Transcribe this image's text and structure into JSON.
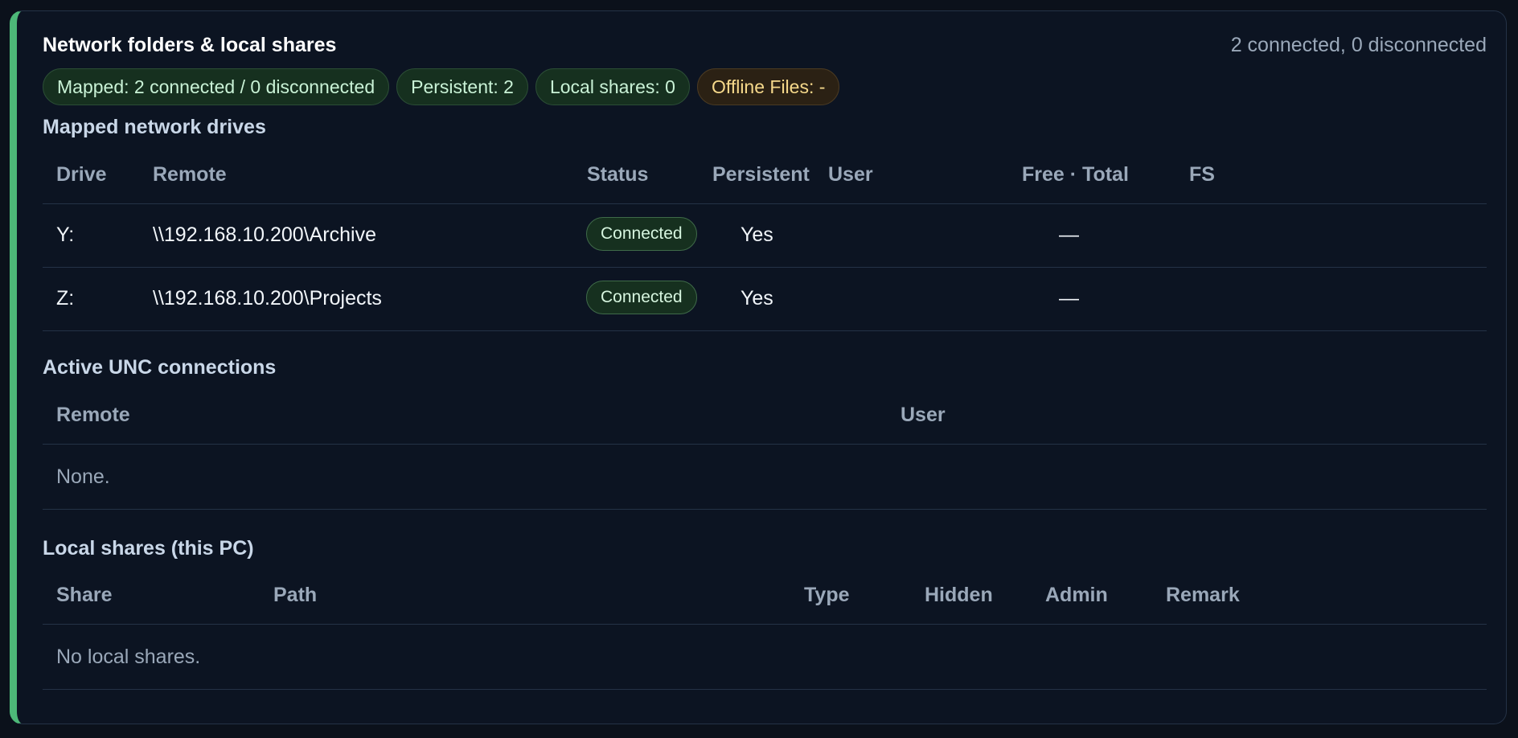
{
  "header": {
    "title": "Network folders & local shares",
    "summary": "2 connected, 0 disconnected"
  },
  "chips": [
    {
      "label": "Mapped: 2 connected / 0 disconnected",
      "tone": "green"
    },
    {
      "label": "Persistent: 2",
      "tone": "green"
    },
    {
      "label": "Local shares: 0",
      "tone": "green"
    },
    {
      "label": "Offline Files: -",
      "tone": "warn"
    }
  ],
  "mapped": {
    "title": "Mapped network drives",
    "columns": [
      "Drive",
      "Remote",
      "Status",
      "Persistent",
      "User",
      "Free · Total",
      "FS"
    ],
    "rows": [
      {
        "drive": "Y:",
        "remote": "\\\\192.168.10.200\\Archive",
        "status": "Connected",
        "persistent": "Yes",
        "user": "",
        "free_total": "—",
        "fs": ""
      },
      {
        "drive": "Z:",
        "remote": "\\\\192.168.10.200\\Projects",
        "status": "Connected",
        "persistent": "Yes",
        "user": "",
        "free_total": "—",
        "fs": ""
      }
    ]
  },
  "unc": {
    "title": "Active UNC connections",
    "columns": [
      "Remote",
      "User"
    ],
    "empty_text": "None."
  },
  "local": {
    "title": "Local shares (this PC)",
    "columns": [
      "Share",
      "Path",
      "Type",
      "Hidden",
      "Admin",
      "Remark"
    ],
    "empty_text": "No local shares."
  },
  "colors": {
    "accent": "#4db878",
    "background": "#0c1422",
    "chip_green_bg": "#16301f",
    "chip_warn_text": "#f6d98b"
  }
}
